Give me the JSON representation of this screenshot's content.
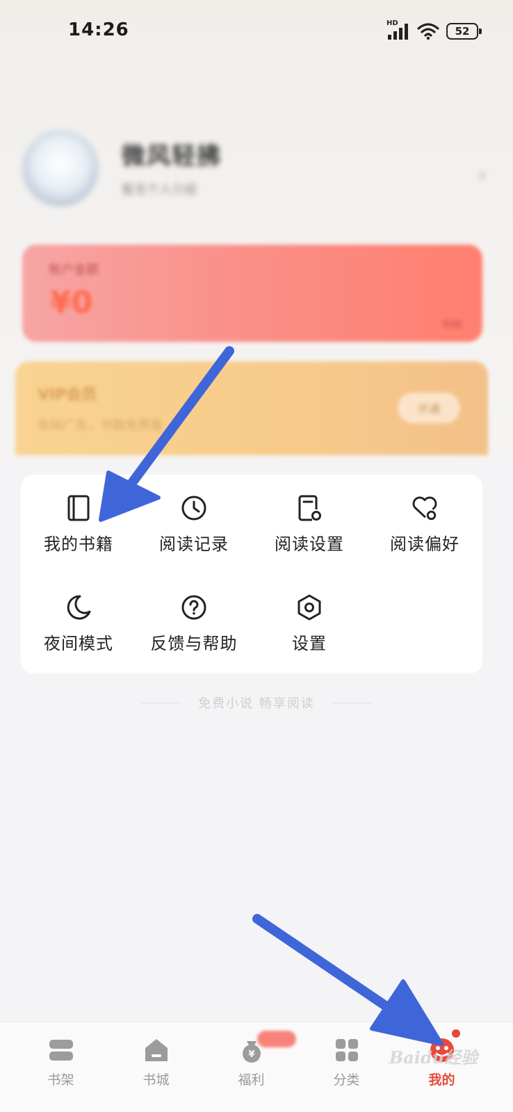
{
  "status_bar": {
    "time": "14:26",
    "network": "HD",
    "battery": "52"
  },
  "profile": {
    "name": "微风轻拂",
    "subtitle": "暂无个人介绍"
  },
  "account_card": {
    "label": "账户金额",
    "value": "¥0",
    "more": "明细"
  },
  "vip_card": {
    "title": "VIP会员",
    "desc": "免除广告，书籍免费看",
    "button": "开通"
  },
  "menu": {
    "items": [
      {
        "label": "我的书籍",
        "icon": "book-icon"
      },
      {
        "label": "阅读记录",
        "icon": "clock-icon"
      },
      {
        "label": "阅读设置",
        "icon": "reading-settings-icon"
      },
      {
        "label": "阅读偏好",
        "icon": "heart-settings-icon"
      },
      {
        "label": "夜间模式",
        "icon": "moon-icon"
      },
      {
        "label": "反馈与帮助",
        "icon": "help-icon"
      },
      {
        "label": "设置",
        "icon": "hexagon-settings-icon"
      }
    ]
  },
  "slogan": "免费小说 畅享阅读",
  "bottom_nav": {
    "items": [
      {
        "label": "书架",
        "icon": "bookshelf-icon",
        "active": false
      },
      {
        "label": "书城",
        "icon": "bookstore-icon",
        "active": false
      },
      {
        "label": "福利",
        "icon": "welfare-icon",
        "active": false
      },
      {
        "label": "分类",
        "icon": "category-icon",
        "active": false
      },
      {
        "label": "我的",
        "icon": "profile-icon",
        "active": true
      }
    ]
  },
  "watermark": "Baidu经验",
  "colors": {
    "accent": "#e84a3c",
    "arrow": "#3f66d9",
    "vip": "#f7ca8a",
    "account": "#fa8e86"
  }
}
